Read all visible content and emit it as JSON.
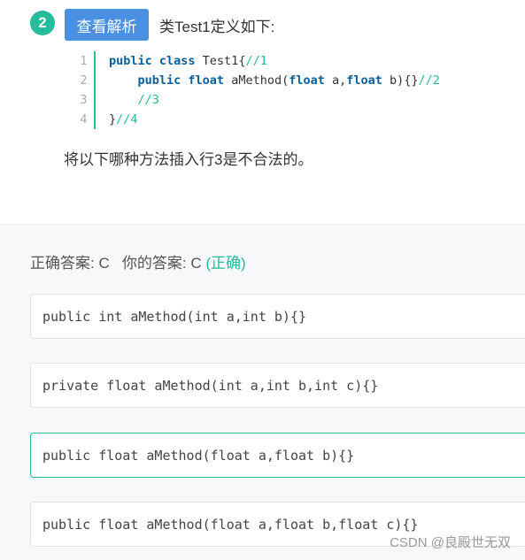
{
  "question": {
    "number": "2",
    "analysis_button": "查看解析",
    "title": "类Test1定义如下:",
    "code_lines": [
      {
        "no": "1"
      },
      {
        "no": "2"
      },
      {
        "no": "3"
      },
      {
        "no": "4"
      }
    ],
    "code": {
      "l1_kw": "public class",
      "l1_txt": " Test1{",
      "l1_cm": "//1",
      "l2_kw1": "public float",
      "l2_txt1": " aMethod(",
      "l2_kw2": "float",
      "l2_txt2": " a,",
      "l2_kw3": "float",
      "l2_txt3": " b){}",
      "l2_cm": "//2",
      "l3_cm": "//3",
      "l4_txt": "}",
      "l4_cm": "//4"
    },
    "text": "将以下哪种方法插入行3是不合法的。"
  },
  "result": {
    "correct_label": "正确答案: C",
    "yours_label": "你的答案: C",
    "status": "(正确)"
  },
  "options": [
    {
      "code": "public int aMethod(int a,int b){}"
    },
    {
      "code": "private float aMethod(int a,int b,int c){}"
    },
    {
      "code": "public float aMethod(float a,float b){}"
    },
    {
      "code": "public float aMethod(float a,float b,float c){}"
    }
  ],
  "watermark": "CSDN @良殿世无双",
  "colors": {
    "accent": "#25bb9b",
    "button": "#4a90e2",
    "keyword": "#0a5f9a"
  }
}
